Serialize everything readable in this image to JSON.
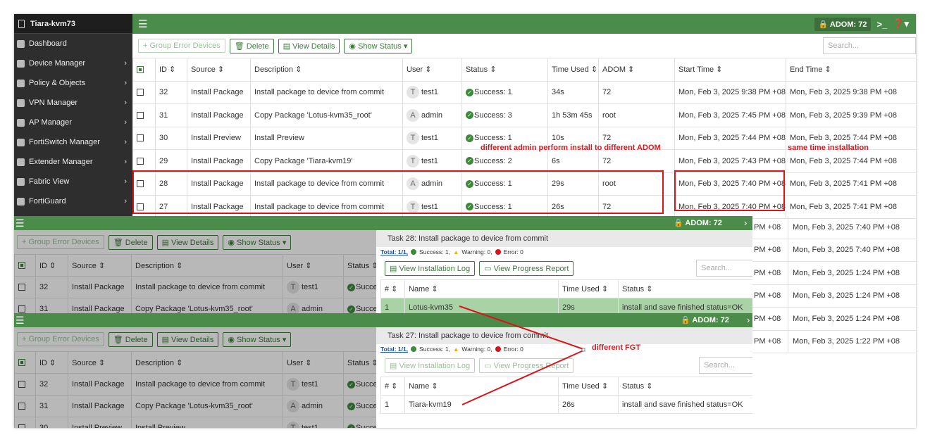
{
  "sidebar": {
    "device": "Tiara-kvm73",
    "items": [
      {
        "label": "Dashboard",
        "icon": "dashboard-icon",
        "arrow": false
      },
      {
        "label": "Device Manager",
        "icon": "device-manager-icon",
        "arrow": true
      },
      {
        "label": "Policy & Objects",
        "icon": "policy-icon",
        "arrow": true
      },
      {
        "label": "VPN Manager",
        "icon": "vpn-icon",
        "arrow": true
      },
      {
        "label": "AP Manager",
        "icon": "ap-icon",
        "arrow": true
      },
      {
        "label": "FortiSwitch Manager",
        "icon": "switch-icon",
        "arrow": true
      },
      {
        "label": "Extender Manager",
        "icon": "extender-icon",
        "arrow": true
      },
      {
        "label": "Fabric View",
        "icon": "fabric-icon",
        "arrow": true
      },
      {
        "label": "FortiGuard",
        "icon": "fortiguard-icon",
        "arrow": true
      }
    ]
  },
  "topbar": {
    "adom": "ADOM: 72"
  },
  "toolbar": {
    "group_error": "+ Group Error Devices",
    "delete": "Delete",
    "view_details": "View Details",
    "show_status": "Show Status",
    "search_placeholder": "Search..."
  },
  "table": {
    "headers": [
      "ID",
      "Source",
      "Description",
      "User",
      "Status",
      "Time Used",
      "ADOM",
      "Start Time",
      "End Time"
    ],
    "rows": [
      [
        "32",
        "Install Package",
        "Install package to device from commit",
        "T",
        "test1",
        "Success: 1",
        "34s",
        "72",
        "Mon, Feb 3, 2025 9:38 PM +08",
        "Mon, Feb 3, 2025 9:38 PM +08"
      ],
      [
        "31",
        "Install Package",
        "Copy Package 'Lotus-kvm35_root'",
        "A",
        "admin",
        "Success: 3",
        "1h 53m 45s",
        "root",
        "Mon, Feb 3, 2025 7:45 PM +08",
        "Mon, Feb 3, 2025 9:39 PM +08"
      ],
      [
        "30",
        "Install Preview",
        "Install Preview",
        "T",
        "test1",
        "Success: 1",
        "10s",
        "72",
        "Mon, Feb 3, 2025 7:44 PM +08",
        "Mon, Feb 3, 2025 7:44 PM +08"
      ],
      [
        "29",
        "Install Package",
        "Copy Package 'Tiara-kvm19'",
        "T",
        "test1",
        "Success: 2",
        "6s",
        "72",
        "Mon, Feb 3, 2025 7:43 PM +08",
        "Mon, Feb 3, 2025 7:44 PM +08"
      ],
      [
        "28",
        "Install Package",
        "Install package to device from commit",
        "A",
        "admin",
        "Success: 1",
        "29s",
        "root",
        "Mon, Feb 3, 2025 7:40 PM +08",
        "Mon, Feb 3, 2025 7:41 PM +08"
      ],
      [
        "27",
        "Install Package",
        "Install package to device from commit",
        "T",
        "test1",
        "Success: 1",
        "26s",
        "72",
        "Mon, Feb 3, 2025 7:40 PM +08",
        "Mon, Feb 3, 2025 7:41 PM +08"
      ]
    ],
    "end_fragments": [
      "PM +08",
      "PM +08",
      "PM +08",
      "PM +08",
      "PM +08",
      "PM +08",
      "Mon, Feb 3, 2025 1:22 PM +08"
    ],
    "end_full": [
      "0 PM +08",
      "0 PM +08",
      "4 PM +08",
      "4 PM +08",
      "4 PM +08"
    ]
  },
  "overlay1": {
    "adom": "ADOM: 72",
    "rows": [
      [
        "32",
        "Install Package",
        "Install package to device from commit",
        "T",
        "test1",
        "Success"
      ],
      [
        "31",
        "Install Package",
        "Copy Package 'Lotus-kvm35_root'",
        "A",
        "admin",
        "Success"
      ]
    ]
  },
  "overlay2": {
    "adom": "ADOM: 72",
    "rows": [
      [
        "32",
        "Install Package",
        "Install package to device from commit",
        "T",
        "test1",
        "Success"
      ],
      [
        "31",
        "Install Package",
        "Copy Package 'Lotus-kvm35_root'",
        "A",
        "admin",
        "Success"
      ],
      [
        "30",
        "Install Preview",
        "Install Preview",
        "T",
        "test1",
        "Success"
      ]
    ]
  },
  "ov_headers": [
    "ID",
    "Source",
    "Description",
    "User",
    "Status"
  ],
  "task28": {
    "title": "Task 28: Install package to device from commit",
    "total": "Total: 1/1,",
    "success": "Success: 1,",
    "warning": "Warning: 0,",
    "error": "Error: 0",
    "log": "View Installation Log",
    "progress": "View Progress Report",
    "search": "Search...",
    "headers": [
      "#",
      "Name",
      "Time Used",
      "Status"
    ],
    "row": [
      "1",
      "Lotus-kvm35",
      "29s",
      "install and save finished status=OK"
    ]
  },
  "task27": {
    "title": "Task 27: Install package to device from commit",
    "total": "Total: 1/1,",
    "success": "Success: 1,",
    "warning": "Warning: 0,",
    "error": "Error: 0",
    "log": "View Installation Log",
    "progress": "View Progress Report",
    "search": "Search...",
    "headers": [
      "#",
      "Name",
      "Time Used",
      "Status"
    ],
    "row": [
      "1",
      "Tiara-kvm19",
      "26s",
      "install and save finished status=OK"
    ]
  },
  "annotations": {
    "admin": "different admin perform install to different ADOM",
    "same_time": "same time installation",
    "fgt": "different FGT"
  },
  "colors": {
    "accent": "#4c8c4a",
    "annotation": "#e0161b"
  }
}
